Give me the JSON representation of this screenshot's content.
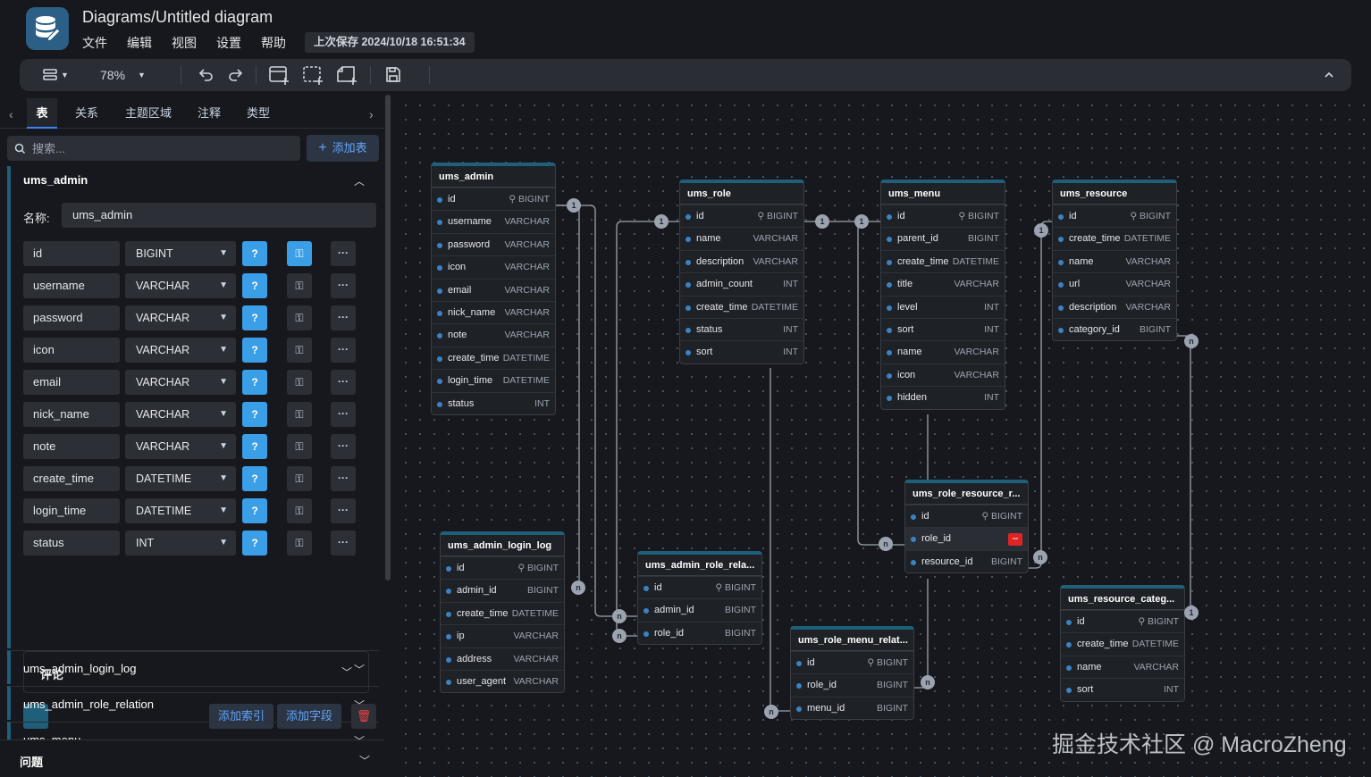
{
  "app": {
    "title": "Diagrams/Untitled diagram",
    "menus": [
      "文件",
      "编辑",
      "视图",
      "设置",
      "帮助"
    ],
    "last_saved": "上次保存 2024/10/18 16:51:34"
  },
  "toolbar": {
    "zoom": "78%"
  },
  "sidebar": {
    "tabs": [
      "表",
      "关系",
      "主题区域",
      "注释",
      "类型"
    ],
    "search_placeholder": "搜索...",
    "add_table": "添加表",
    "expanded_table": {
      "title": "ums_admin",
      "name_label": "名称:",
      "name_value": "ums_admin",
      "fields": [
        {
          "name": "id",
          "type": "BIGINT",
          "null_label": "?",
          "primary": true
        },
        {
          "name": "username",
          "type": "VARCHAR",
          "null_label": "?",
          "primary": false
        },
        {
          "name": "password",
          "type": "VARCHAR",
          "null_label": "?",
          "primary": false
        },
        {
          "name": "icon",
          "type": "VARCHAR",
          "null_label": "?",
          "primary": false
        },
        {
          "name": "email",
          "type": "VARCHAR",
          "null_label": "?",
          "primary": false
        },
        {
          "name": "nick_name",
          "type": "VARCHAR",
          "null_label": "?",
          "primary": false
        },
        {
          "name": "note",
          "type": "VARCHAR",
          "null_label": "?",
          "primary": false
        },
        {
          "name": "create_time",
          "type": "DATETIME",
          "null_label": "?",
          "primary": false
        },
        {
          "name": "login_time",
          "type": "DATETIME",
          "null_label": "?",
          "primary": false
        },
        {
          "name": "status",
          "type": "INT",
          "null_label": "?",
          "primary": false
        }
      ],
      "comment_label": "评论",
      "add_index": "添加索引",
      "add_field": "添加字段"
    },
    "collapsed_tables": [
      "ums_admin_login_log",
      "ums_admin_role_relation",
      "ums_menu"
    ],
    "issues_label": "问题"
  },
  "tables": [
    {
      "name": "ums_admin",
      "rows": [
        [
          "id",
          "BIGINT"
        ],
        [
          "username",
          "VARCHAR"
        ],
        [
          "password",
          "VARCHAR"
        ],
        [
          "icon",
          "VARCHAR"
        ],
        [
          "email",
          "VARCHAR"
        ],
        [
          "nick_name",
          "VARCHAR"
        ],
        [
          "note",
          "VARCHAR"
        ],
        [
          "create_time",
          "DATETIME"
        ],
        [
          "login_time",
          "DATETIME"
        ],
        [
          "status",
          "INT"
        ]
      ]
    },
    {
      "name": "ums_role",
      "rows": [
        [
          "id",
          "BIGINT"
        ],
        [
          "name",
          "VARCHAR"
        ],
        [
          "description",
          "VARCHAR"
        ],
        [
          "admin_count",
          "INT"
        ],
        [
          "create_time",
          "DATETIME"
        ],
        [
          "status",
          "INT"
        ],
        [
          "sort",
          "INT"
        ]
      ]
    },
    {
      "name": "ums_menu",
      "rows": [
        [
          "id",
          "BIGINT"
        ],
        [
          "parent_id",
          "BIGINT"
        ],
        [
          "create_time",
          "DATETIME"
        ],
        [
          "title",
          "VARCHAR"
        ],
        [
          "level",
          "INT"
        ],
        [
          "sort",
          "INT"
        ],
        [
          "name",
          "VARCHAR"
        ],
        [
          "icon",
          "VARCHAR"
        ],
        [
          "hidden",
          "INT"
        ]
      ]
    },
    {
      "name": "ums_resource",
      "rows": [
        [
          "id",
          "BIGINT"
        ],
        [
          "create_time",
          "DATETIME"
        ],
        [
          "name",
          "VARCHAR"
        ],
        [
          "url",
          "VARCHAR"
        ],
        [
          "description",
          "VARCHAR"
        ],
        [
          "category_id",
          "BIGINT"
        ]
      ]
    },
    {
      "name": "ums_role_resource_r...",
      "rows": [
        [
          "id",
          "BIGINT"
        ],
        [
          "role_id",
          ""
        ],
        [
          "resource_id",
          "BIGINT"
        ]
      ]
    },
    {
      "name": "ums_admin_login_log",
      "rows": [
        [
          "id",
          "BIGINT"
        ],
        [
          "admin_id",
          "BIGINT"
        ],
        [
          "create_time",
          "DATETIME"
        ],
        [
          "ip",
          "VARCHAR"
        ],
        [
          "address",
          "VARCHAR"
        ],
        [
          "user_agent",
          "VARCHAR"
        ]
      ]
    },
    {
      "name": "ums_admin_role_rela...",
      "rows": [
        [
          "id",
          "BIGINT"
        ],
        [
          "admin_id",
          "BIGINT"
        ],
        [
          "role_id",
          "BIGINT"
        ]
      ]
    },
    {
      "name": "ums_role_menu_relat...",
      "rows": [
        [
          "id",
          "BIGINT"
        ],
        [
          "role_id",
          "BIGINT"
        ],
        [
          "menu_id",
          "BIGINT"
        ]
      ]
    },
    {
      "name": "ums_resource_categ...",
      "rows": [
        [
          "id",
          "BIGINT"
        ],
        [
          "create_time",
          "DATETIME"
        ],
        [
          "name",
          "VARCHAR"
        ],
        [
          "sort",
          "INT"
        ]
      ]
    }
  ],
  "relation_badges": {
    "one": "1",
    "many": "n"
  },
  "watermark": "掘金技术社区 @ MacroZheng",
  "colors": {
    "accent": "#3b9fe8",
    "table_header": "#1f5f7a",
    "background": "#16181d",
    "delete": "#dc2626"
  }
}
